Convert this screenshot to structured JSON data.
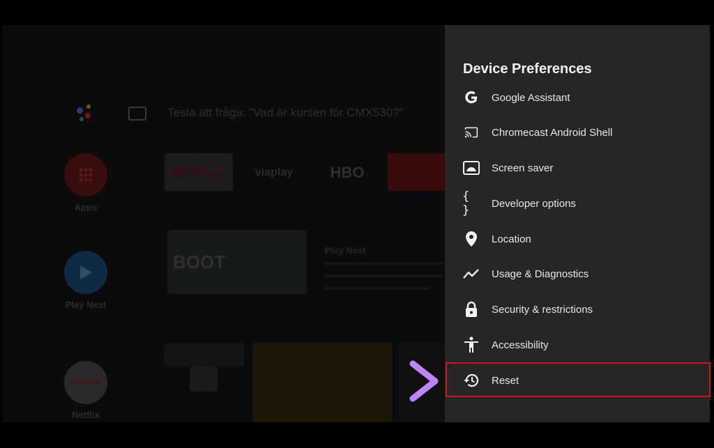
{
  "background": {
    "search_hint": "Testa att fråga: \"Vad är kursen för CMX530?\"",
    "left_apps": [
      {
        "label": "Apps"
      },
      {
        "label": "Play Next"
      },
      {
        "label": "Netflix"
      }
    ],
    "tiles": {
      "netflix": "NETFLIX",
      "viaplay": "viaplay",
      "hbo": "HBO",
      "boot": "BOOT",
      "playnext_heading": "Play Next"
    }
  },
  "panel": {
    "title": "Device Preferences",
    "items": [
      {
        "label": "Google Assistant",
        "icon": "google-icon"
      },
      {
        "label": "Chromecast Android Shell",
        "icon": "cast-icon"
      },
      {
        "label": "Screen saver",
        "icon": "screen-saver-icon"
      },
      {
        "label": "Developer options",
        "icon": "braces-icon"
      },
      {
        "label": "Location",
        "icon": "location-pin-icon"
      },
      {
        "label": "Usage & Diagnostics",
        "icon": "diagnostics-icon"
      },
      {
        "label": "Security & restrictions",
        "icon": "lock-icon"
      },
      {
        "label": "Accessibility",
        "icon": "accessibility-icon"
      },
      {
        "label": "Reset",
        "icon": "history-icon"
      }
    ]
  },
  "colors": {
    "highlight": "#d0141a",
    "arrow_start": "#8fd3f4",
    "arrow_end": "#c084fc",
    "panel_bg": "#262626"
  }
}
